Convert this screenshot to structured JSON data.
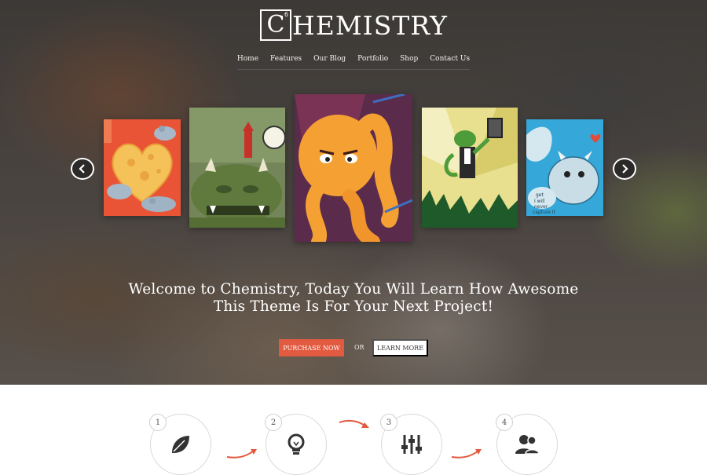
{
  "logo": {
    "letter": "C",
    "number": "6",
    "text": "HEMISTRY"
  },
  "nav": {
    "items": [
      "Home",
      "Features",
      "Our Blog",
      "Portfolio",
      "Shop",
      "Contact Us"
    ]
  },
  "carousel": {
    "prev_icon": "chevron-left-icon",
    "next_icon": "chevron-right-icon",
    "slides": [
      {
        "name": "cheese-heart-mice"
      },
      {
        "name": "green-monster-castle"
      },
      {
        "name": "orange-octopus"
      },
      {
        "name": "lizard-with-tablet"
      },
      {
        "name": "blue-monsters",
        "caption": "get I will never capture it"
      }
    ]
  },
  "hero": {
    "welcome_line1": "Welcome to Chemistry, Today You Will Learn How Awesome",
    "welcome_line2": "This Theme Is For Your Next Project!",
    "purchase_label": "PURCHASE NOW",
    "or_label": "OR",
    "learn_label": "LEARN MORE"
  },
  "colors": {
    "accent": "#e25a3f",
    "hero_text": "#ffffff"
  },
  "steps": [
    {
      "number": "1",
      "icon": "leaf-icon"
    },
    {
      "number": "2",
      "icon": "lightbulb-icon"
    },
    {
      "number": "3",
      "icon": "sliders-icon"
    },
    {
      "number": "4",
      "icon": "users-icon"
    }
  ]
}
